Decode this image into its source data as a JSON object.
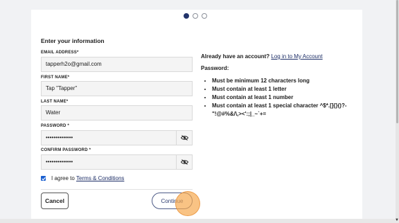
{
  "steps": [
    "step-1",
    "step-2",
    "step-3"
  ],
  "active_step": 1,
  "form": {
    "heading": "Enter your information",
    "email_label": "EMAIL ADDRESS*",
    "email_value": "tapperh2o@gmail.com",
    "first_name_label": "FIRST NAME*",
    "first_name_value": "Tap \"Tapper\"",
    "last_name_label": "LAST NAME*",
    "last_name_value": "Water",
    "password_label": "PASSWORD *",
    "password_value": "••••••••••••••",
    "confirm_label": "CONFIRM PASSWORD *",
    "confirm_value": "••••••••••••••",
    "agree_prefix": "I agree to",
    "terms_link": "Terms & Conditions",
    "cancel_label": "Cancel",
    "continue_label": "Continue"
  },
  "side": {
    "already": "Already have an account?",
    "login_link": "Log in to My Account",
    "password_title": "Password:",
    "rules": [
      "Must be minimum 12 characters long",
      "Must contain at least 1 letter",
      "Must contain at least 1 number",
      "Must contain at least 1 special character ^$*.[]{}()?-\"!@#%&/\\,><':;|_~`+="
    ]
  },
  "colors": {
    "accent": "#22336a",
    "checkbox": "#1a5fd0",
    "highlight": "#f6aa50"
  },
  "icons": {
    "password_toggle": "eye-slash-icon"
  }
}
